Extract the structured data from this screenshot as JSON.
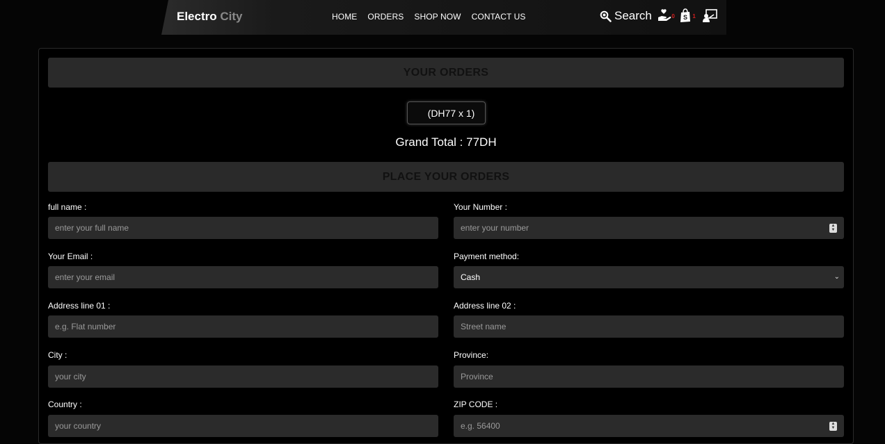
{
  "header": {
    "logo_main": "Electro",
    "logo_accent": "City",
    "nav": [
      "HOME",
      "ORDERS",
      "SHOP NOW",
      "CONTACT US"
    ],
    "search_label": "Search",
    "wishlist_count": "0",
    "cart_count": "1"
  },
  "orders": {
    "title": "YOUR ORDERS",
    "item": "(DH77 x 1)",
    "grand_total": "Grand Total : 77DH"
  },
  "form": {
    "title": "PLACE YOUR ORDERS",
    "full_name": {
      "label": "full name :",
      "placeholder": "enter your full name"
    },
    "number": {
      "label": "Your Number :",
      "placeholder": "enter your number"
    },
    "email": {
      "label": "Your Email :",
      "placeholder": "enter your email"
    },
    "payment": {
      "label": "Payment method:",
      "value": "Cash"
    },
    "address1": {
      "label": "Address line 01 :",
      "placeholder": "e.g. Flat number"
    },
    "address2": {
      "label": "Address line 02 :",
      "placeholder": "Street name"
    },
    "city": {
      "label": "City :",
      "placeholder": "your city"
    },
    "province": {
      "label": "Province:",
      "placeholder": "Province"
    },
    "country": {
      "label": "Country :",
      "placeholder": "your country"
    },
    "zip": {
      "label": "ZIP CODE :",
      "placeholder": "e.g. 56400"
    }
  },
  "colors": {
    "background": "#050505",
    "panel": "#2a2a2a",
    "field": "#2b2b2b",
    "badge": "#d32020"
  }
}
